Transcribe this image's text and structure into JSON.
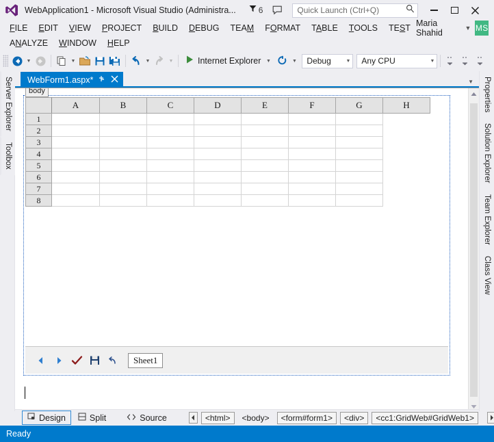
{
  "titlebar": {
    "app_title": "WebApplication1 - Microsoft Visual Studio (Administra...",
    "logo_icon": "visual-studio-logo",
    "notification_icon": "notification-flag-icon",
    "notification_count": "6",
    "feedback_icon": "feedback-speech-bubble-icon",
    "quick_launch_placeholder": "Quick Launch (Ctrl+Q)",
    "quick_launch_value": "",
    "search_icon": "search-magnifier-icon",
    "minimize_label": "Minimize",
    "maximize_label": "Maximize",
    "close_label": "Close"
  },
  "menubar": {
    "row1": [
      {
        "label": "FILE",
        "accel": "F"
      },
      {
        "label": "EDIT",
        "accel": "E"
      },
      {
        "label": "VIEW",
        "accel": "V"
      },
      {
        "label": "PROJECT",
        "accel": "P"
      },
      {
        "label": "BUILD",
        "accel": "B"
      },
      {
        "label": "DEBUG",
        "accel": "D"
      },
      {
        "label": "TEAM",
        "accel": "M"
      },
      {
        "label": "FORMAT",
        "accel": "O"
      },
      {
        "label": "TABLE",
        "accel": "A"
      },
      {
        "label": "TOOLS",
        "accel": "T"
      },
      {
        "label": "TEST",
        "accel": "S"
      }
    ],
    "row2": [
      {
        "label": "ANALYZE",
        "accel": "A"
      },
      {
        "label": "WINDOW",
        "accel": "W"
      },
      {
        "label": "HELP",
        "accel": "H"
      }
    ],
    "user_name": "Maria Shahid",
    "user_initials": "MS",
    "user_caret_icon": "chevron-down-icon",
    "avatar_color": "#41b883"
  },
  "toolbar": {
    "nav_back_icon": "navigate-back-icon",
    "nav_forward_icon": "navigate-forward-icon",
    "new_item_icon": "new-item-icon",
    "open_file_icon": "open-file-icon",
    "save_icon": "save-icon",
    "save_all_icon": "save-all-icon",
    "undo_icon": "undo-arrow-icon",
    "redo_icon": "redo-arrow-icon",
    "start_icon": "start-debug-play-icon",
    "start_label": "Internet Explorer",
    "refresh_icon": "refresh-icon",
    "config_value": "Debug",
    "platform_value": "Any CPU",
    "caret_icon": "chevron-down-icon",
    "extra_icons": [
      "align-icon-1",
      "align-icon-2",
      "align-icon-3"
    ]
  },
  "left_dock": {
    "tabs": [
      {
        "label": "Server Explorer"
      },
      {
        "label": "Toolbox"
      }
    ]
  },
  "right_dock": {
    "tabs": [
      {
        "label": "Properties"
      },
      {
        "label": "Solution Explorer"
      },
      {
        "label": "Team Explorer"
      },
      {
        "label": "Class View"
      }
    ]
  },
  "document": {
    "tab_title": "WebForm1.aspx*",
    "pin_icon": "pin-icon",
    "close_icon": "close-x-icon",
    "tab_list_icon": "chevron-down-icon",
    "body_tag_label": "body",
    "active_tab_color": "#007acc"
  },
  "spreadsheet": {
    "columns": [
      "A",
      "B",
      "C",
      "D",
      "E",
      "F",
      "G",
      "H"
    ],
    "rows": [
      "1",
      "2",
      "3",
      "4",
      "5",
      "6",
      "7",
      "8"
    ],
    "cells": [
      [
        "",
        "",
        "",
        "",
        "",
        "",
        "",
        ""
      ],
      [
        "",
        "",
        "",
        "",
        "",
        "",
        "",
        ""
      ],
      [
        "",
        "",
        "",
        "",
        "",
        "",
        "",
        ""
      ],
      [
        "",
        "",
        "",
        "",
        "",
        "",
        "",
        ""
      ],
      [
        "",
        "",
        "",
        "",
        "",
        "",
        "",
        ""
      ],
      [
        "",
        "",
        "",
        "",
        "",
        "",
        "",
        ""
      ],
      [
        "",
        "",
        "",
        "",
        "",
        "",
        "",
        ""
      ],
      [
        "",
        "",
        "",
        "",
        "",
        "",
        "",
        ""
      ]
    ],
    "toolbar": {
      "prev_icon": "previous-sheet-arrow-icon",
      "next_icon": "next-sheet-arrow-icon",
      "confirm_icon": "confirm-checkmark-icon",
      "save_icon": "save-floppy-icon",
      "undo_icon": "undo-arrow-icon"
    },
    "sheet_name": "Sheet1"
  },
  "scrollbar": {
    "up_icon": "scroll-up-arrow-icon",
    "down_icon": "scroll-down-arrow-icon"
  },
  "viewbar": {
    "buttons": [
      {
        "label": "Design",
        "icon": "design-view-icon",
        "active": true
      },
      {
        "label": "Split",
        "icon": "split-view-icon",
        "active": false
      },
      {
        "label": "Source",
        "icon": "source-view-icon",
        "active": false
      }
    ],
    "tag_nav_left_icon": "tag-nav-left-icon",
    "tag_nav_right_icon": "tag-nav-right-icon",
    "tags": [
      {
        "label": "<html>",
        "style": "boxed"
      },
      {
        "label": "<body>",
        "style": "plain"
      },
      {
        "label": "<form#form1>",
        "style": "boxed"
      },
      {
        "label": "<div>",
        "style": "boxed"
      },
      {
        "label": "<cc1:GridWeb#GridWeb1>",
        "style": "boxed"
      }
    ]
  },
  "statusbar": {
    "text": "Ready",
    "color": "#007acc"
  }
}
